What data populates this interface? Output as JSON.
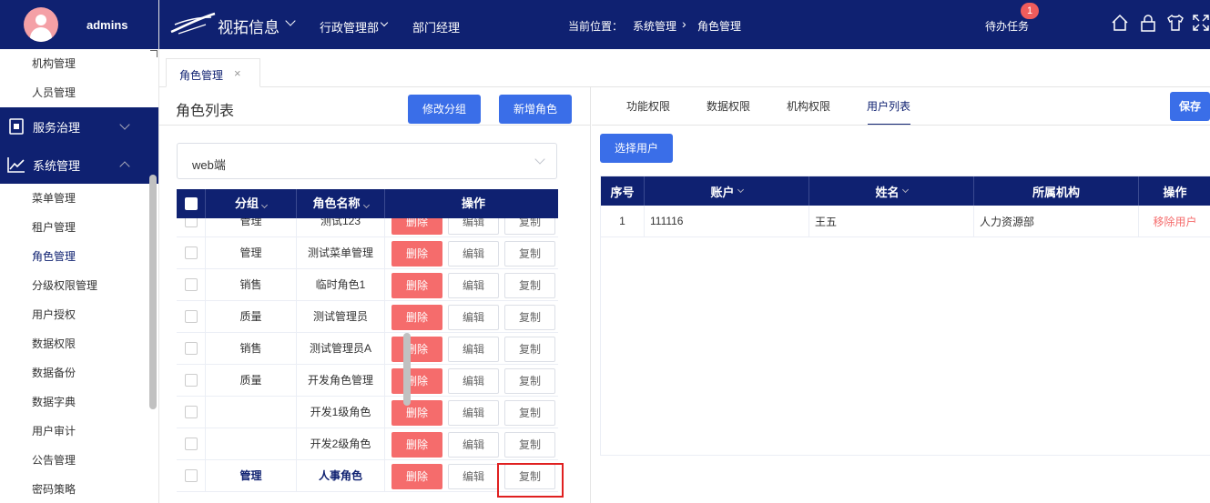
{
  "sidebar": {
    "username": "admins",
    "items_top": [
      "机构管理",
      "人员管理"
    ],
    "group_service": "服务治理",
    "group_system": "系统管理",
    "items_system": [
      "菜单管理",
      "租户管理",
      "角色管理",
      "分级权限管理",
      "用户授权",
      "数据权限",
      "数据备份",
      "数据字典",
      "用户审计",
      "公告管理",
      "密码策略"
    ],
    "active_item": "角色管理"
  },
  "header": {
    "brand": "视拓信息",
    "nav1": "行政管理部",
    "nav2": "部门经理",
    "crumb_prefix": "当前位置：",
    "crumb_1": "系统管理",
    "crumb_sep": "›",
    "crumb_2": "角色管理",
    "todo": "待办任务",
    "badge": "1"
  },
  "tabs": [
    {
      "label": "角色管理",
      "close": "×"
    }
  ],
  "left": {
    "title": "角色列表",
    "btn_modify_group": "修改分组",
    "btn_add_role": "新增角色",
    "select_value": "web端",
    "columns": {
      "group": "分组",
      "name": "角色名称",
      "ops": "操作"
    },
    "ops": {
      "del": "删除",
      "edit": "编辑",
      "copy": "复制"
    },
    "rows": [
      {
        "group": "管理",
        "name": "测试123"
      },
      {
        "group": "管理",
        "name": "测试菜单管理"
      },
      {
        "group": "销售",
        "name": "临时角色1"
      },
      {
        "group": "质量",
        "name": "测试管理员"
      },
      {
        "group": "销售",
        "name": "测试管理员A"
      },
      {
        "group": "质量",
        "name": "开发角色管理"
      },
      {
        "group": "",
        "name": "开发1级角色"
      },
      {
        "group": "",
        "name": "开发2级角色"
      },
      {
        "group": "管理",
        "name": "人事角色"
      }
    ]
  },
  "right": {
    "tabs": [
      "功能权限",
      "数据权限",
      "机构权限",
      "用户列表"
    ],
    "active_tab": "用户列表",
    "btn_save": "保存",
    "btn_select_user": "选择用户",
    "columns": {
      "index": "序号",
      "account": "账户",
      "name": "姓名",
      "org": "所属机构",
      "ops": "操作"
    },
    "rows": [
      {
        "index": "1",
        "account": "111116",
        "name": "王五",
        "org": "人力资源部",
        "op": "移除用户"
      }
    ]
  },
  "colors": {
    "primary": "#0f2171",
    "button": "#3a6ee8",
    "danger": "#f56c6c",
    "highlight": "#e02020"
  }
}
